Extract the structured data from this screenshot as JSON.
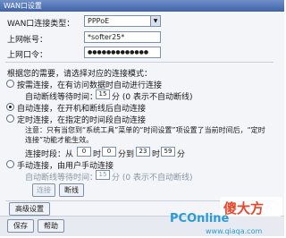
{
  "window": {
    "title": "WAN口设置"
  },
  "form": {
    "conn_type_label": "WAN口连接类型：",
    "conn_type_value": "PPPoE",
    "account_label": "上网帐号：",
    "account_value": "*softer25*",
    "password_label": "上网口令：",
    "password_mask": "●●●●●●●●●●●●●"
  },
  "mode": {
    "prompt": "根据您的需要，请选择对应的连接模式：",
    "on_demand_label": "按需连接，在有访问数据时自动进行连接",
    "on_demand_idle_prefix": "自动断线等待时间：",
    "on_demand_idle_value": "15",
    "on_demand_idle_suffix": "分 (0 表示不自动断线)",
    "auto_label": "自动连接，在开机和断线后自动连接",
    "timed_label": "定时连接，在指定的时间段自动连接",
    "timed_note": "注意：只有当您到“系统工具”菜单的“时间设置”项设置了当前时间后，“定时连接”功能才能生效。",
    "timed_note_line1": "注意：只有当您到“系统工具”菜单的“时间设置”项设置了当前时间后，“定时",
    "timed_note_line2": "连接”功能才能生效。",
    "timed_range_prefix": "连接时段：从",
    "timed_from_h": "0",
    "timed_h1_unit": "时",
    "timed_from_m": "0",
    "timed_m1_unit": "分到",
    "timed_to_h": "23",
    "timed_h2_unit": "时",
    "timed_to_m": "59",
    "timed_m2_unit": "分",
    "manual_label": "手动连接，由用户手动连接",
    "manual_idle_prefix": "自动断线等待时间：",
    "manual_idle_value": "15",
    "manual_idle_suffix": "分 (0 表示不自动断线)"
  },
  "buttons": {
    "connect": "连接",
    "disconnect": "断线",
    "advanced": "高级设置",
    "save": "保存",
    "help": "帮助"
  },
  "watermark": {
    "logo_text": "PCOnline",
    "chinese_text": "傻大方",
    "url": "www.qiaqa.com"
  },
  "colors": {
    "accent": "#3f63a8",
    "watermark": "#2a9ad9"
  }
}
